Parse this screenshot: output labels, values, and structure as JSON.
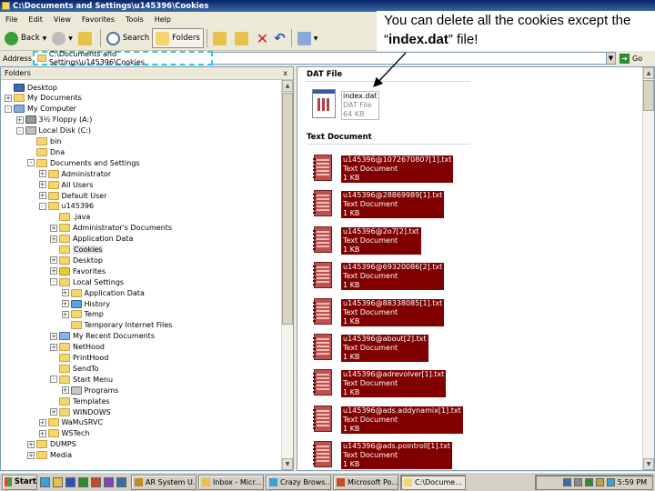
{
  "window": {
    "title": "C:\\Documents and Settings\\u145396\\Cookies"
  },
  "menu": [
    "File",
    "Edit",
    "View",
    "Favorites",
    "Tools",
    "Help"
  ],
  "toolbar": {
    "back_label": "Back",
    "search_label": "Search",
    "folders_label": "Folders"
  },
  "address": {
    "label": "Address",
    "value": "C:\\Documents and Settings\\u145396\\Cookies",
    "go_label": "Go"
  },
  "callout": {
    "line1": "You can delete all the cookies except the",
    "q1": "“",
    "filename": "index.dat",
    "q2": "”",
    "rest": " file!"
  },
  "folders_pane": {
    "title": "Folders",
    "close": "x",
    "tree": [
      {
        "label": "Desktop",
        "level": 0,
        "toggle": "",
        "icon": "desktop-icon"
      },
      {
        "label": "My Documents",
        "level": 0,
        "toggle": "+",
        "icon": "folder-icon"
      },
      {
        "label": "My Computer",
        "level": 0,
        "toggle": "-",
        "icon": "computer-icon"
      },
      {
        "label": "3½ Floppy (A:)",
        "level": 1,
        "toggle": "+",
        "icon": "floppy-icon"
      },
      {
        "label": "Local Disk (C:)",
        "level": 1,
        "toggle": "-",
        "icon": "drive-icon"
      },
      {
        "label": "bin",
        "level": 2,
        "toggle": "",
        "icon": "folder-icon"
      },
      {
        "label": "Dna",
        "level": 2,
        "toggle": "",
        "icon": "folder-icon"
      },
      {
        "label": "Documents and Settings",
        "level": 2,
        "toggle": "-",
        "icon": "folder-icon"
      },
      {
        "label": "Administrator",
        "level": 3,
        "toggle": "+",
        "icon": "folder-icon"
      },
      {
        "label": "All Users",
        "level": 3,
        "toggle": "+",
        "icon": "folder-icon"
      },
      {
        "label": "Default User",
        "level": 3,
        "toggle": "+",
        "icon": "folder-icon"
      },
      {
        "label": "u145396",
        "level": 3,
        "toggle": "-",
        "icon": "folder-icon"
      },
      {
        "label": ".java",
        "level": 4,
        "toggle": "",
        "icon": "folder-icon"
      },
      {
        "label": "Administrator's Documents",
        "level": 4,
        "toggle": "+",
        "icon": "folder-icon"
      },
      {
        "label": "Application Data",
        "level": 4,
        "toggle": "+",
        "icon": "folder-icon"
      },
      {
        "label": "Cookies",
        "level": 4,
        "toggle": "",
        "icon": "folder-icon",
        "selected": true
      },
      {
        "label": "Desktop",
        "level": 4,
        "toggle": "+",
        "icon": "folder-icon"
      },
      {
        "label": "Favorites",
        "level": 4,
        "toggle": "+",
        "icon": "star-icon"
      },
      {
        "label": "Local Settings",
        "level": 4,
        "toggle": "-",
        "icon": "folder-icon"
      },
      {
        "label": "Application Data",
        "level": 5,
        "toggle": "+",
        "icon": "folder-icon"
      },
      {
        "label": "History",
        "level": 5,
        "toggle": "+",
        "icon": "history-icon"
      },
      {
        "label": "Temp",
        "level": 5,
        "toggle": "+",
        "icon": "folder-icon"
      },
      {
        "label": "Temporary Internet Files",
        "level": 5,
        "toggle": "",
        "icon": "folder-icon"
      },
      {
        "label": "My Recent Documents",
        "level": 4,
        "toggle": "+",
        "icon": "recent-icon"
      },
      {
        "label": "NetHood",
        "level": 4,
        "toggle": "+",
        "icon": "folder-icon"
      },
      {
        "label": "PrintHood",
        "level": 4,
        "toggle": "",
        "icon": "folder-icon"
      },
      {
        "label": "SendTo",
        "level": 4,
        "toggle": "",
        "icon": "folder-icon"
      },
      {
        "label": "Start Menu",
        "level": 4,
        "toggle": "-",
        "icon": "folder-icon"
      },
      {
        "label": "Programs",
        "level": 5,
        "toggle": "+",
        "icon": "programs-icon"
      },
      {
        "label": "Templates",
        "level": 4,
        "toggle": "",
        "icon": "folder-icon"
      },
      {
        "label": "WINDOWS",
        "level": 4,
        "toggle": "+",
        "icon": "folder-icon"
      },
      {
        "label": "WaMuSRVC",
        "level": 3,
        "toggle": "+",
        "icon": "folder-icon"
      },
      {
        "label": "WSTech",
        "level": 3,
        "toggle": "+",
        "icon": "folder-icon"
      },
      {
        "label": "DUMPS",
        "level": 2,
        "toggle": "+",
        "icon": "folder-icon"
      },
      {
        "label": "Media",
        "level": 2,
        "toggle": "+",
        "icon": "folder-icon"
      }
    ]
  },
  "content": {
    "groups": [
      {
        "title": "DAT File"
      },
      {
        "title": "Text Document"
      }
    ],
    "dat_file": {
      "name": "index.dat",
      "type": "DAT File",
      "size": "64 KB"
    },
    "text_files": [
      {
        "name": "u145396@1072670807[1].txt",
        "type": "Text Document",
        "size": "1 KB"
      },
      {
        "name": "u145396@28869989[1].txt",
        "type": "Text Document",
        "size": "1 KB"
      },
      {
        "name": "u145396@2o7[2].txt",
        "type": "Text Document",
        "size": "1 KB"
      },
      {
        "name": "u145396@69320086[2].txt",
        "type": "Text Document",
        "size": "1 KB"
      },
      {
        "name": "u145396@88338085[1].txt",
        "type": "Text Document",
        "size": "1 KB"
      },
      {
        "name": "u145396@about[2].txt",
        "type": "Text Document",
        "size": "1 KB"
      },
      {
        "name": "u145396@adrevolver[1].txt",
        "type": "Text Document",
        "size": "1 KB"
      },
      {
        "name": "u145396@ads.addynamix[1].txt",
        "type": "Text Document",
        "size": "1 KB"
      },
      {
        "name": "u145396@ads.pointroll[1].txt",
        "type": "Text Document",
        "size": "1 KB"
      }
    ]
  },
  "taskbar": {
    "start_label": "Start",
    "tasks": [
      "AR System U...",
      "Inbox - Micr...",
      "Crazy Brows...",
      "Microsoft Po...",
      "C:\\Docume..."
    ],
    "clock": "5:59 PM"
  }
}
